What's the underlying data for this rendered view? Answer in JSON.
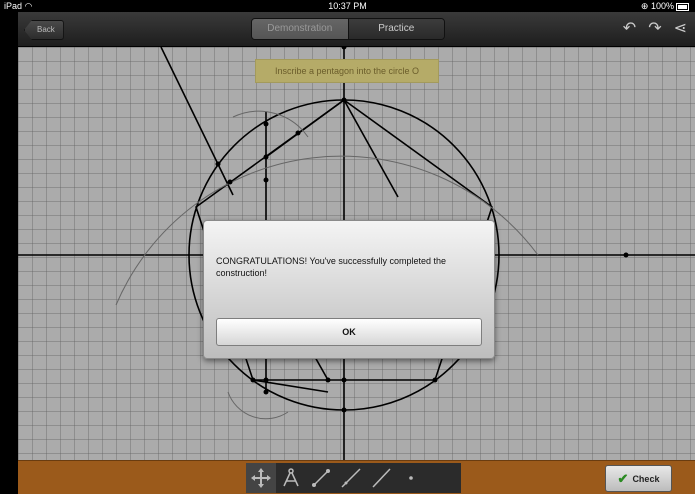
{
  "status_bar": {
    "device": "iPad",
    "time": "10:37 PM",
    "battery": "100%",
    "icons": [
      "wifi-icon",
      "lock-rotation-icon",
      "battery-icon"
    ]
  },
  "nav": {
    "back_label": "Back",
    "tabs": [
      {
        "label": "Demonstration",
        "active": true
      },
      {
        "label": "Practice",
        "active": false
      }
    ],
    "icons": [
      "undo-icon",
      "redo-icon",
      "share-icon"
    ]
  },
  "canvas": {
    "instruction": "Inscribe a pentagon into the circle O"
  },
  "dialog": {
    "message": "CONGRATULATIONS! You've successfully completed the construction!",
    "ok_label": "OK"
  },
  "toolbar": {
    "tools": [
      "move-tool-icon",
      "compass-tool-icon",
      "segment-tool-icon",
      "line-tool-icon",
      "ray-tool-icon",
      "point-tool-icon"
    ],
    "check_label": "Check",
    "colors": {
      "toolbar_bg": "#9b5a1b",
      "canvas_bg": "#ababab",
      "instruction_bg": "#b5ab68",
      "check_green": "#2a8a22"
    }
  }
}
